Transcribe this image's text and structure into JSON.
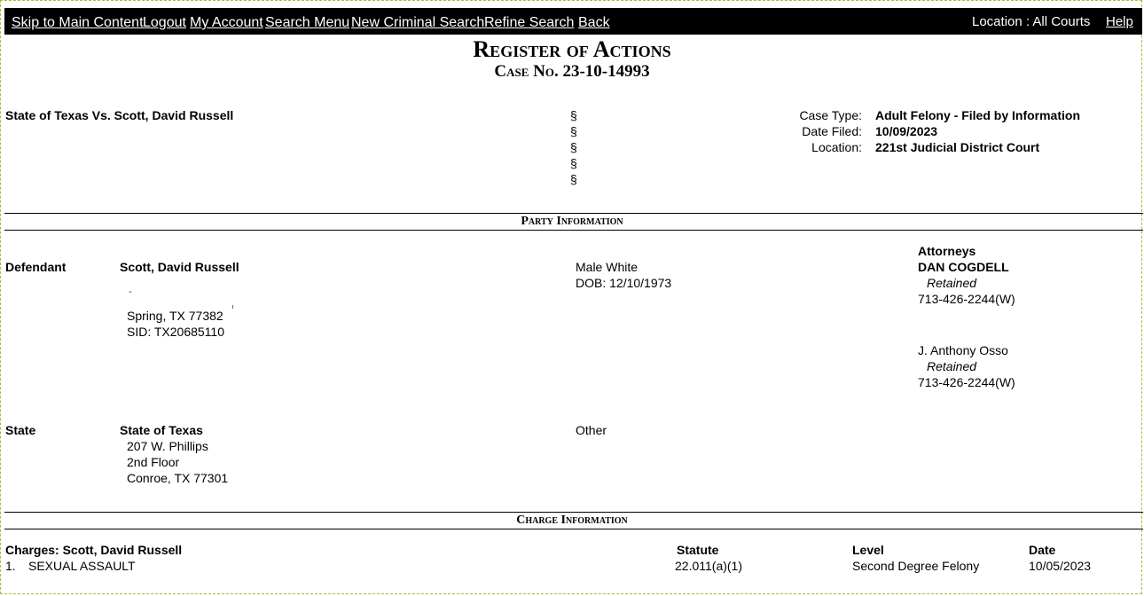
{
  "nav": {
    "skip": "Skip to Main Content",
    "logout": "Logout",
    "my_account": "My Account",
    "search_menu": "Search Menu",
    "new_search": "New Criminal Search",
    "refine": "Refine Search",
    "back": "Back",
    "location": "Location : All Courts",
    "help": "Help"
  },
  "header": {
    "title": "Register of Actions",
    "case_no": "Case No. 23-10-14993"
  },
  "case": {
    "style": "State of Texas Vs. Scott, David Russell",
    "section_mark": "§",
    "type_label": "Case Type:",
    "type_value": "Adult Felony - Filed by Information",
    "filed_label": "Date Filed:",
    "filed_value": "10/09/2023",
    "location_label": "Location:",
    "location_value": "221st Judicial District Court"
  },
  "party_section": "Party Information",
  "defendant": {
    "role": "Defendant",
    "name": "Scott, David Russell",
    "dash": "-",
    "city": "Spring, TX 77382",
    "sid": "SID: TX20685110",
    "gender_race": "Male White",
    "dob": "DOB: 12/10/1973",
    "attorneys_label": "Attorneys",
    "attorney1_name": "DAN COGDELL",
    "attorney1_status": "Retained",
    "attorney1_phone": "713-426-2244(W)",
    "attorney2_name": "J. Anthony Osso",
    "attorney2_status": "Retained",
    "attorney2_phone": "713-426-2244(W)"
  },
  "state": {
    "role": "State",
    "name": "State of Texas",
    "addr1": "207 W. Phillips",
    "addr2": "2nd Floor",
    "addr3": "Conroe, TX 77301",
    "other": "Other"
  },
  "charge_section": "Charge Information",
  "charges": {
    "heading": "Charges: Scott, David Russell",
    "statute_label": "Statute",
    "level_label": "Level",
    "date_label": "Date",
    "row_num": "1.",
    "offense": "SEXUAL ASSAULT",
    "statute": "22.011(a)(1)",
    "level": "Second Degree Felony",
    "date": "10/05/2023"
  }
}
